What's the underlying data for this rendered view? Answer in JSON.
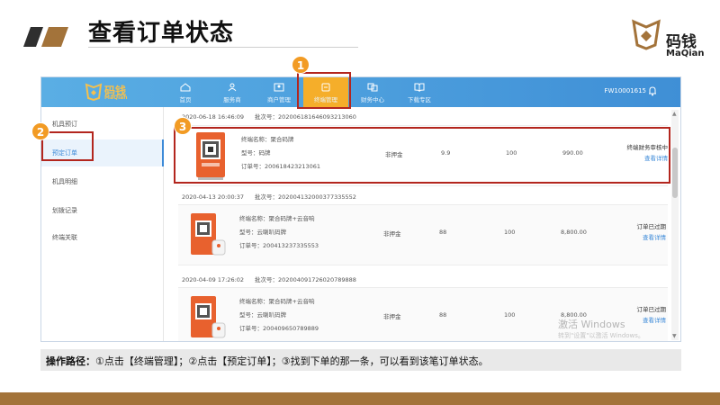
{
  "slide": {
    "title": "查看订单状态",
    "brand_name": "码钱",
    "brand_en": "MaQian",
    "note_label": "操作路径：",
    "note_text": "①点击【终端管理】；②点击【预定订单】；③找到下单的那一条，可以看到该笔订单状态。"
  },
  "app": {
    "logo_cn": "码钱",
    "logo_en": "MaQian",
    "account": "FW10001615",
    "nav": [
      {
        "label": "首页",
        "icon": "home-icon"
      },
      {
        "label": "服务商",
        "icon": "user-icon"
      },
      {
        "label": "商户管理",
        "icon": "image-icon"
      },
      {
        "label": "终端管理",
        "icon": "terminal-icon"
      },
      {
        "label": "财务中心",
        "icon": "finance-icon"
      },
      {
        "label": "下载专区",
        "icon": "book-icon"
      }
    ],
    "sidebar": [
      "机具预订",
      "预定订单",
      "机具明细",
      "划拨记录",
      "终端关联"
    ],
    "orders": [
      {
        "time": "2020-06-18 16:46:09",
        "lot": "批次号：20200618164609321306​0",
        "name": "终端名称：聚合码牌",
        "model": "型号：码牌",
        "order_no": "订单号：200618423213061",
        "pay": "非押金",
        "price": "9.9",
        "qty": "100",
        "total": "990.00",
        "status": "终端财务审核中",
        "action": "查看详情"
      },
      {
        "time": "2020-04-13 20:00:37",
        "lot": "批次号：20200413200037733555​2",
        "name": "终端名称：聚合码牌+云音响",
        "model": "型号：云喇叭码牌",
        "order_no": "订单号：200413237335553",
        "pay": "非押金",
        "price": "88",
        "qty": "100",
        "total": "8,800.00",
        "status": "订单已过期",
        "action": "查看详情"
      },
      {
        "time": "2020-04-09 17:26:02",
        "lot": "批次号：20200409172602078988​8",
        "name": "终端名称：聚合码牌+云音响",
        "model": "型号：云喇叭码牌",
        "order_no": "订单号：200409650789889",
        "pay": "非押金",
        "price": "88",
        "qty": "100",
        "total": "8,800.00",
        "status": "订单已过期",
        "action": "查看详情"
      }
    ],
    "watermark_title": "激活 Windows",
    "watermark_sub": "转到\"设置\"以激活 Windows。"
  },
  "callouts": [
    "1",
    "2",
    "3"
  ],
  "colors": {
    "accent": "#a3733a",
    "header_blue": "#4a9fe0",
    "active_nav": "#f5ae2a",
    "badge": "#f29b24",
    "highlight": "#b3261e"
  }
}
